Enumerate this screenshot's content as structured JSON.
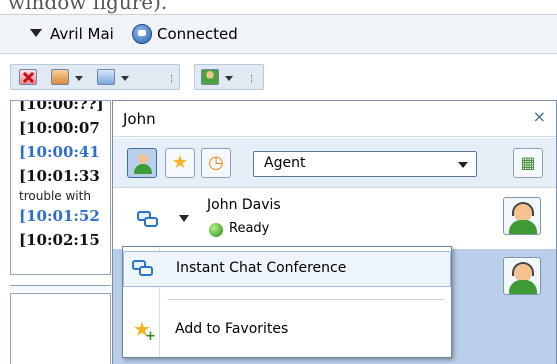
{
  "caption": "window figure).",
  "status_bar": {
    "agent_name": "Avril Mai",
    "status": "Connected"
  },
  "transcript": {
    "top_partial": "[10:00:??]",
    "lines": [
      {
        "text": "[10:00:07",
        "color": "black"
      },
      {
        "text": "[10:00:41",
        "color": "blue"
      },
      {
        "text": "[10:01:33",
        "color": "black"
      },
      {
        "text": "trouble with",
        "color": "small"
      },
      {
        "text": "[10:01:52",
        "color": "blue"
      },
      {
        "text": "[10:02:15",
        "color": "black"
      }
    ]
  },
  "popup": {
    "title": "John",
    "close": "×",
    "filter_selected": "Agent",
    "contacts": [
      {
        "name": "John Davis",
        "status": "Ready"
      }
    ]
  },
  "context_menu": {
    "items": [
      {
        "label": "Instant Chat Conference"
      },
      {
        "label": "Add to Favorites"
      }
    ]
  },
  "colors": {
    "accent_blue": "#2d6fd1",
    "ready_green": "#258a16",
    "selected_row": "#b9cee8"
  }
}
